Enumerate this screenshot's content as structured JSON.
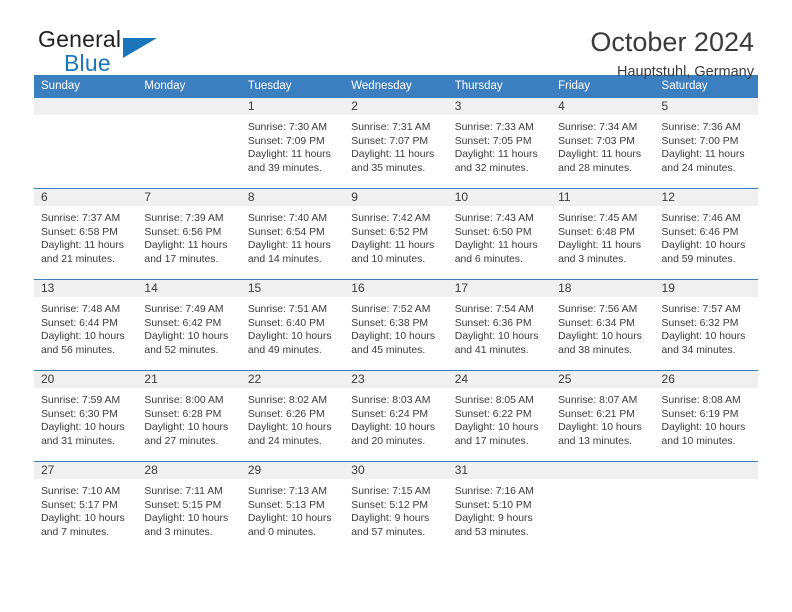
{
  "brand": {
    "name_top": "General",
    "name_bottom": "Blue",
    "accent_color": "#1b75bb"
  },
  "header": {
    "title": "October 2024",
    "subtitle": "Hauptstuhl, Germany"
  },
  "calendar": {
    "header_color": "#3c7fc1",
    "daynum_background": "#f0f0f0",
    "weekdays": [
      "Sunday",
      "Monday",
      "Tuesday",
      "Wednesday",
      "Thursday",
      "Friday",
      "Saturday"
    ],
    "labels": {
      "sunrise": "Sunrise:",
      "sunset": "Sunset:",
      "daylight": "Daylight:"
    },
    "weeks": [
      [
        {
          "day": "",
          "empty": true
        },
        {
          "day": "",
          "empty": true
        },
        {
          "day": "1",
          "sunrise": "Sunrise: 7:30 AM",
          "sunset": "Sunset: 7:09 PM",
          "daylight_1": "Daylight: 11 hours",
          "daylight_2": "and 39 minutes."
        },
        {
          "day": "2",
          "sunrise": "Sunrise: 7:31 AM",
          "sunset": "Sunset: 7:07 PM",
          "daylight_1": "Daylight: 11 hours",
          "daylight_2": "and 35 minutes."
        },
        {
          "day": "3",
          "sunrise": "Sunrise: 7:33 AM",
          "sunset": "Sunset: 7:05 PM",
          "daylight_1": "Daylight: 11 hours",
          "daylight_2": "and 32 minutes."
        },
        {
          "day": "4",
          "sunrise": "Sunrise: 7:34 AM",
          "sunset": "Sunset: 7:03 PM",
          "daylight_1": "Daylight: 11 hours",
          "daylight_2": "and 28 minutes."
        },
        {
          "day": "5",
          "sunrise": "Sunrise: 7:36 AM",
          "sunset": "Sunset: 7:00 PM",
          "daylight_1": "Daylight: 11 hours",
          "daylight_2": "and 24 minutes."
        }
      ],
      [
        {
          "day": "6",
          "sunrise": "Sunrise: 7:37 AM",
          "sunset": "Sunset: 6:58 PM",
          "daylight_1": "Daylight: 11 hours",
          "daylight_2": "and 21 minutes."
        },
        {
          "day": "7",
          "sunrise": "Sunrise: 7:39 AM",
          "sunset": "Sunset: 6:56 PM",
          "daylight_1": "Daylight: 11 hours",
          "daylight_2": "and 17 minutes."
        },
        {
          "day": "8",
          "sunrise": "Sunrise: 7:40 AM",
          "sunset": "Sunset: 6:54 PM",
          "daylight_1": "Daylight: 11 hours",
          "daylight_2": "and 14 minutes."
        },
        {
          "day": "9",
          "sunrise": "Sunrise: 7:42 AM",
          "sunset": "Sunset: 6:52 PM",
          "daylight_1": "Daylight: 11 hours",
          "daylight_2": "and 10 minutes."
        },
        {
          "day": "10",
          "sunrise": "Sunrise: 7:43 AM",
          "sunset": "Sunset: 6:50 PM",
          "daylight_1": "Daylight: 11 hours",
          "daylight_2": "and 6 minutes."
        },
        {
          "day": "11",
          "sunrise": "Sunrise: 7:45 AM",
          "sunset": "Sunset: 6:48 PM",
          "daylight_1": "Daylight: 11 hours",
          "daylight_2": "and 3 minutes."
        },
        {
          "day": "12",
          "sunrise": "Sunrise: 7:46 AM",
          "sunset": "Sunset: 6:46 PM",
          "daylight_1": "Daylight: 10 hours",
          "daylight_2": "and 59 minutes."
        }
      ],
      [
        {
          "day": "13",
          "sunrise": "Sunrise: 7:48 AM",
          "sunset": "Sunset: 6:44 PM",
          "daylight_1": "Daylight: 10 hours",
          "daylight_2": "and 56 minutes."
        },
        {
          "day": "14",
          "sunrise": "Sunrise: 7:49 AM",
          "sunset": "Sunset: 6:42 PM",
          "daylight_1": "Daylight: 10 hours",
          "daylight_2": "and 52 minutes."
        },
        {
          "day": "15",
          "sunrise": "Sunrise: 7:51 AM",
          "sunset": "Sunset: 6:40 PM",
          "daylight_1": "Daylight: 10 hours",
          "daylight_2": "and 49 minutes."
        },
        {
          "day": "16",
          "sunrise": "Sunrise: 7:52 AM",
          "sunset": "Sunset: 6:38 PM",
          "daylight_1": "Daylight: 10 hours",
          "daylight_2": "and 45 minutes."
        },
        {
          "day": "17",
          "sunrise": "Sunrise: 7:54 AM",
          "sunset": "Sunset: 6:36 PM",
          "daylight_1": "Daylight: 10 hours",
          "daylight_2": "and 41 minutes."
        },
        {
          "day": "18",
          "sunrise": "Sunrise: 7:56 AM",
          "sunset": "Sunset: 6:34 PM",
          "daylight_1": "Daylight: 10 hours",
          "daylight_2": "and 38 minutes."
        },
        {
          "day": "19",
          "sunrise": "Sunrise: 7:57 AM",
          "sunset": "Sunset: 6:32 PM",
          "daylight_1": "Daylight: 10 hours",
          "daylight_2": "and 34 minutes."
        }
      ],
      [
        {
          "day": "20",
          "sunrise": "Sunrise: 7:59 AM",
          "sunset": "Sunset: 6:30 PM",
          "daylight_1": "Daylight: 10 hours",
          "daylight_2": "and 31 minutes."
        },
        {
          "day": "21",
          "sunrise": "Sunrise: 8:00 AM",
          "sunset": "Sunset: 6:28 PM",
          "daylight_1": "Daylight: 10 hours",
          "daylight_2": "and 27 minutes."
        },
        {
          "day": "22",
          "sunrise": "Sunrise: 8:02 AM",
          "sunset": "Sunset: 6:26 PM",
          "daylight_1": "Daylight: 10 hours",
          "daylight_2": "and 24 minutes."
        },
        {
          "day": "23",
          "sunrise": "Sunrise: 8:03 AM",
          "sunset": "Sunset: 6:24 PM",
          "daylight_1": "Daylight: 10 hours",
          "daylight_2": "and 20 minutes."
        },
        {
          "day": "24",
          "sunrise": "Sunrise: 8:05 AM",
          "sunset": "Sunset: 6:22 PM",
          "daylight_1": "Daylight: 10 hours",
          "daylight_2": "and 17 minutes."
        },
        {
          "day": "25",
          "sunrise": "Sunrise: 8:07 AM",
          "sunset": "Sunset: 6:21 PM",
          "daylight_1": "Daylight: 10 hours",
          "daylight_2": "and 13 minutes."
        },
        {
          "day": "26",
          "sunrise": "Sunrise: 8:08 AM",
          "sunset": "Sunset: 6:19 PM",
          "daylight_1": "Daylight: 10 hours",
          "daylight_2": "and 10 minutes."
        }
      ],
      [
        {
          "day": "27",
          "sunrise": "Sunrise: 7:10 AM",
          "sunset": "Sunset: 5:17 PM",
          "daylight_1": "Daylight: 10 hours",
          "daylight_2": "and 7 minutes."
        },
        {
          "day": "28",
          "sunrise": "Sunrise: 7:11 AM",
          "sunset": "Sunset: 5:15 PM",
          "daylight_1": "Daylight: 10 hours",
          "daylight_2": "and 3 minutes."
        },
        {
          "day": "29",
          "sunrise": "Sunrise: 7:13 AM",
          "sunset": "Sunset: 5:13 PM",
          "daylight_1": "Daylight: 10 hours",
          "daylight_2": "and 0 minutes."
        },
        {
          "day": "30",
          "sunrise": "Sunrise: 7:15 AM",
          "sunset": "Sunset: 5:12 PM",
          "daylight_1": "Daylight: 9 hours",
          "daylight_2": "and 57 minutes."
        },
        {
          "day": "31",
          "sunrise": "Sunrise: 7:16 AM",
          "sunset": "Sunset: 5:10 PM",
          "daylight_1": "Daylight: 9 hours",
          "daylight_2": "and 53 minutes."
        },
        {
          "day": "",
          "empty": true
        },
        {
          "day": "",
          "empty": true
        }
      ]
    ]
  }
}
